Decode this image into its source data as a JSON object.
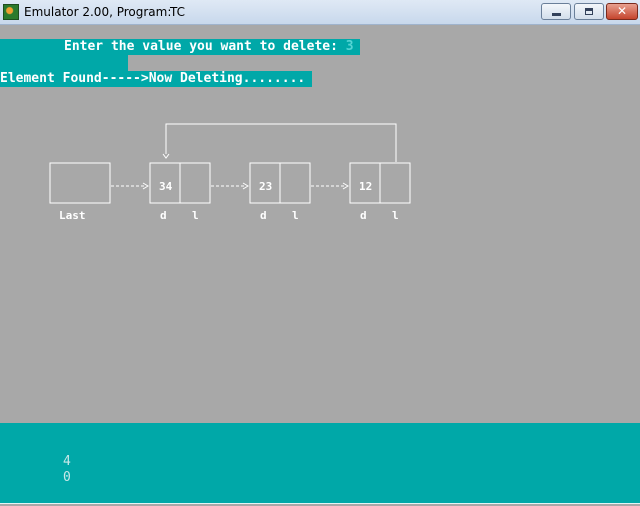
{
  "window": {
    "title": "Emulator 2.00, Program:",
    "program": "TC"
  },
  "screen": {
    "prompt_label": "Enter the value you want to delete: ",
    "prompt_value": "3",
    "status_line": "Element Found----->Now Deleting........"
  },
  "linked_list": {
    "head_label": "Last",
    "nodes": [
      {
        "value": "34",
        "data_label": "d",
        "link_label": "l"
      },
      {
        "value": "23",
        "data_label": "d",
        "link_label": "l"
      },
      {
        "value": "12",
        "data_label": "d",
        "link_label": "l"
      }
    ],
    "circular_link": true
  },
  "bottom_panel": {
    "values": [
      "4",
      "0"
    ]
  },
  "colors": {
    "screen_bg": "#a8a8a8",
    "highlight_bg": "#00a8a8",
    "text": "#ffffff"
  }
}
